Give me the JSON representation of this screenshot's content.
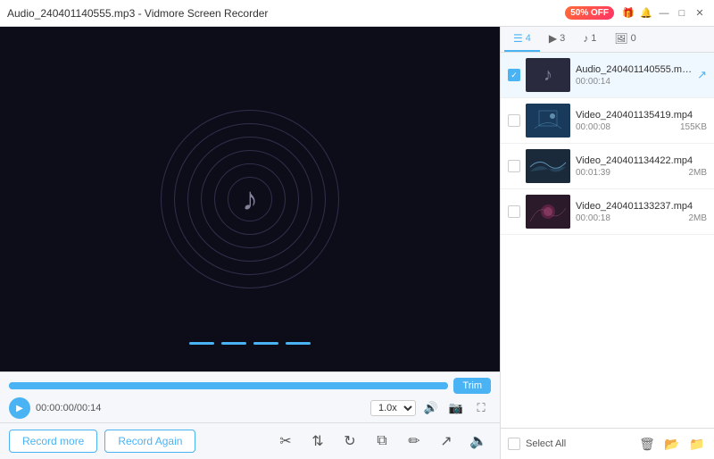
{
  "titlebar": {
    "title": "Audio_240401140555.mp3 - Vidmore Screen Recorder",
    "promo": "50% OFF",
    "buttons": {
      "gift": "🎁",
      "bell": "🔔",
      "minimize": "—",
      "maximize": "□",
      "close": "✕"
    }
  },
  "tabs": [
    {
      "id": "all",
      "icon": "☰",
      "count": "4",
      "active": true
    },
    {
      "id": "video",
      "icon": "▶",
      "count": "3",
      "active": false
    },
    {
      "id": "audio",
      "icon": "♪",
      "count": "1",
      "active": false
    },
    {
      "id": "image",
      "icon": "🖼",
      "count": "0",
      "active": false
    }
  ],
  "files": [
    {
      "id": "audio1",
      "name": "Audio_240401140555.mp3",
      "duration": "00:00:14",
      "size": "",
      "type": "audio",
      "active": true,
      "checked": true
    },
    {
      "id": "video1",
      "name": "Video_240401135419.mp4",
      "duration": "00:00:08",
      "size": "155KB",
      "type": "video1",
      "active": false,
      "checked": false
    },
    {
      "id": "video2",
      "name": "Video_240401134422.mp4",
      "duration": "00:01:39",
      "size": "2MB",
      "type": "video2",
      "active": false,
      "checked": false
    },
    {
      "id": "video3",
      "name": "Video_240401133237.mp4",
      "duration": "00:00:18",
      "size": "2MB",
      "type": "video3",
      "active": false,
      "checked": false
    }
  ],
  "player": {
    "time_current": "00:00:00",
    "time_total": "00:14",
    "speed": "1.0x",
    "trim_label": "Trim"
  },
  "actions": {
    "record_more": "Record more",
    "record_again": "Record Again",
    "select_all": "Select All"
  },
  "colors": {
    "accent": "#4ab3f4",
    "bg_dark": "#0d0d1a"
  }
}
